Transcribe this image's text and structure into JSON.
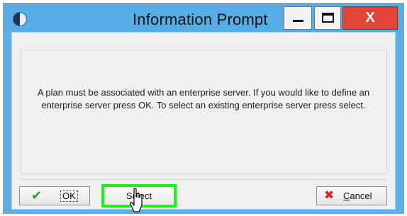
{
  "window": {
    "title": "Information Prompt",
    "minimize_icon": "minimize-icon",
    "maximize_icon": "maximize-icon",
    "close_glyph": "X"
  },
  "message": {
    "text": "A plan must be associated with an enterprise server. If you would like to define an enterprise server press OK. To select an existing enterprise server press select."
  },
  "buttons": {
    "ok": {
      "icon": "checkmark-icon",
      "glyph": "✔",
      "label": "OK"
    },
    "select": {
      "label": "Select",
      "highlight_color": "#1ef01e"
    },
    "cancel": {
      "icon": "red-x-icon",
      "glyph": "✖",
      "prefix": "C",
      "rest": "ancel"
    }
  },
  "colors": {
    "titlebar": "#57aee6",
    "close_button": "#e1453a",
    "client_bg": "#f0f0f0"
  }
}
